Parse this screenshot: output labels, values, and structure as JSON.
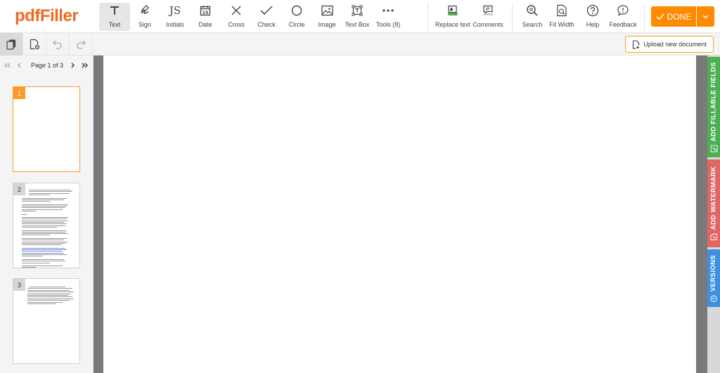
{
  "app": {
    "logo": "pdfFiller"
  },
  "toolbar": {
    "tools": [
      {
        "label": "Text"
      },
      {
        "label": "Sign"
      },
      {
        "label": "Initials"
      },
      {
        "label": "Date"
      },
      {
        "label": "Cross"
      },
      {
        "label": "Check"
      },
      {
        "label": "Circle"
      },
      {
        "label": "Image"
      },
      {
        "label": "Text Box"
      },
      {
        "label": "Tools (8)"
      },
      {
        "label": "Replace text"
      },
      {
        "label": "Comments"
      },
      {
        "label": "Search"
      },
      {
        "label": "Fit Width"
      },
      {
        "label": "Help"
      },
      {
        "label": "Feedback"
      }
    ],
    "initials_glyph": "JS",
    "date_glyph": "15",
    "done_label": "DONE"
  },
  "subbar": {
    "upload_label": "Upload new document"
  },
  "pager": {
    "label": "Page 1 of 3"
  },
  "thumbnails": [
    {
      "num": "1"
    },
    {
      "num": "2"
    },
    {
      "num": "3"
    }
  ],
  "right_tabs": [
    {
      "label": "ADD FILLABLE FIELDS"
    },
    {
      "label": "ADD WATERMARK"
    },
    {
      "label": "VERSIONS"
    }
  ],
  "colors": {
    "brand": "#f06a22",
    "done": "#ff8a00",
    "fillable_tab": "#4caf50",
    "watermark_tab": "#e06666",
    "versions_tab": "#3d8fe0"
  }
}
